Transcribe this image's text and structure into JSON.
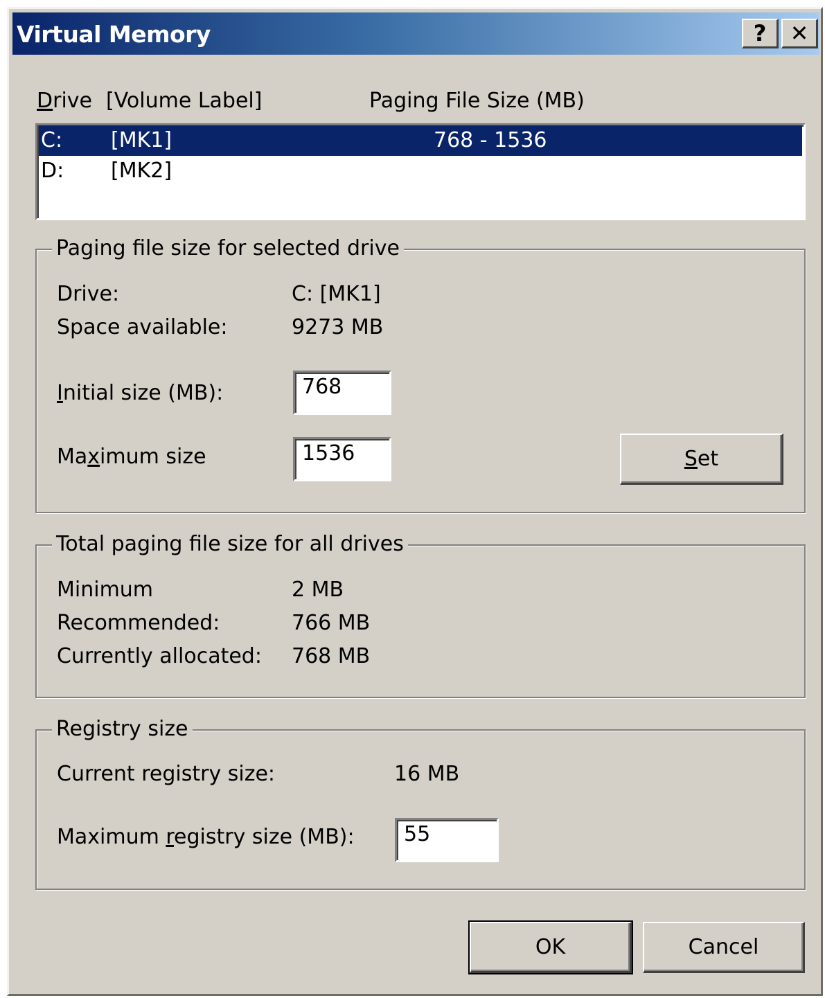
{
  "window": {
    "title": "Virtual Memory",
    "help_glyph": "?",
    "close_glyph": "✕"
  },
  "drive_list": {
    "header_drive_prefix": "D",
    "header_drive_rest": "rive",
    "header_volume": "[Volume Label]",
    "header_size": "Paging File Size (MB)",
    "rows": [
      {
        "drive": "C:",
        "label": "[MK1]",
        "size": "768 - 1536",
        "selected": true
      },
      {
        "drive": "D:",
        "label": "[MK2]",
        "size": "",
        "selected": false
      }
    ]
  },
  "selected_drive": {
    "legend": "Paging file size for selected drive",
    "drive_label": "Drive:",
    "drive_value": "C:  [MK1]",
    "space_label": "Space available:",
    "space_value": "9273 MB",
    "initial_label_hot": "I",
    "initial_label_rest": "nitial size (MB):",
    "initial_value": "768",
    "max_label_pre": "Ma",
    "max_label_hot": "x",
    "max_label_rest": "imum size",
    "max_value": "1536",
    "set_hot": "S",
    "set_rest": "et"
  },
  "totals": {
    "legend": "Total paging file size for all drives",
    "minimum_label": "Minimum",
    "minimum_value": "2 MB",
    "recommended_label": "Recommended:",
    "recommended_value": "766 MB",
    "allocated_label": "Currently allocated:",
    "allocated_value": "768 MB"
  },
  "registry": {
    "legend": "Registry size",
    "current_label": "Current registry size:",
    "current_value": "16 MB",
    "max_label_pre": "Maximum ",
    "max_label_hot": "r",
    "max_label_rest": "egistry size (MB):",
    "max_value": "55"
  },
  "buttons": {
    "ok": "OK",
    "cancel": "Cancel"
  },
  "colors": {
    "face": "#d4d0c8",
    "selection": "#0a246a",
    "title_start": "#0a246a",
    "title_end": "#a6caf0"
  }
}
